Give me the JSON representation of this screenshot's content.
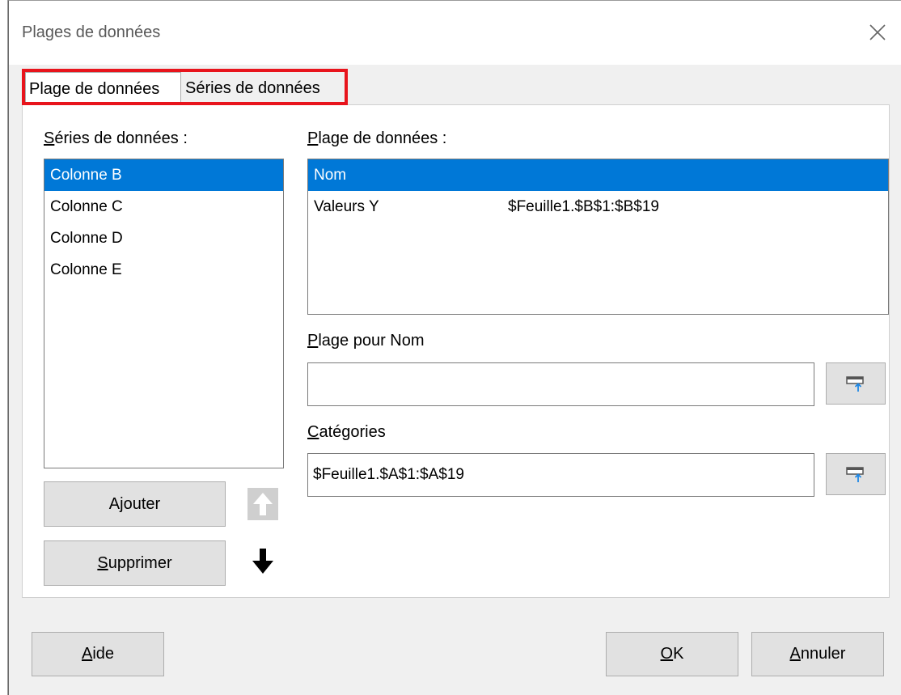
{
  "dialog": {
    "title": "Plages de données"
  },
  "tabs": [
    {
      "label": "Plage de données",
      "active": true
    },
    {
      "label": "Séries de données",
      "active": false
    }
  ],
  "series_panel": {
    "label_accel": "S",
    "label_rest": "éries de données :",
    "items": [
      "Colonne B",
      "Colonne C",
      "Colonne D",
      "Colonne E"
    ],
    "selected_index": 0
  },
  "range_panel": {
    "label_accel": "P",
    "label_rest": "lage de données :",
    "rows": [
      {
        "role": "Nom",
        "range": ""
      },
      {
        "role": "Valeurs Y",
        "range": "$Feuille1.$B$1:$B$19"
      }
    ],
    "selected_index": 0
  },
  "name_range": {
    "label_accel": "P",
    "label_rest": "lage pour Nom",
    "value": ""
  },
  "categories": {
    "label_accel": "C",
    "label_rest": "atégories",
    "value": "$Feuille1.$A$1:$A$19"
  },
  "buttons": {
    "add_accel": "j",
    "add_pre": "A",
    "add_post": "outer",
    "remove_accel": "S",
    "remove_post": "upprimer",
    "help_accel": "A",
    "help_post": "ide",
    "ok_accel": "O",
    "ok_post": "K",
    "cancel_accel": "A",
    "cancel_post": "nnuler"
  },
  "colors": {
    "selection": "#0078d7",
    "highlight_box": "#e8141c"
  }
}
